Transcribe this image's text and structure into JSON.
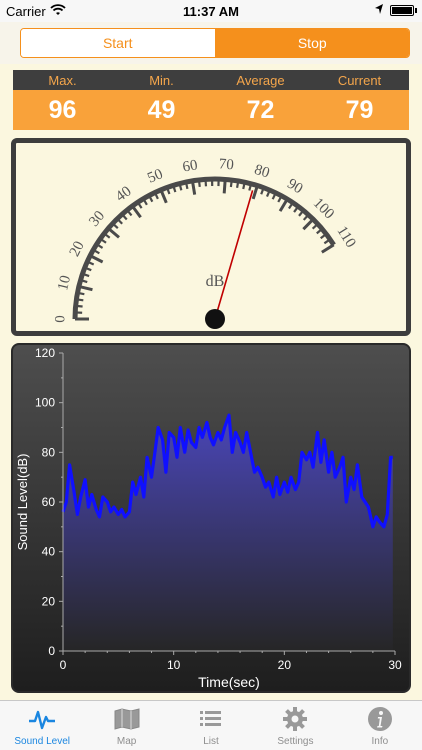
{
  "status_bar": {
    "carrier": "Carrier",
    "time": "11:37 AM"
  },
  "segment": {
    "start_label": "Start",
    "stop_label": "Stop",
    "selected": "Stop"
  },
  "stats": {
    "headers": [
      "Max.",
      "Min.",
      "Average",
      "Current"
    ],
    "values": [
      "96",
      "49",
      "72",
      "79"
    ]
  },
  "gauge": {
    "unit_label": "dB",
    "scale_labels": [
      "0",
      "10",
      "20",
      "30",
      "40",
      "50",
      "60",
      "70",
      "80",
      "90",
      "100",
      "110"
    ],
    "needle_value": 79
  },
  "colors": {
    "accent": "#f5901c",
    "stats_header_bg": "#3e3e3e",
    "stats_value_bg": "#f9a23a",
    "line": "#1010ff",
    "tab_active": "#1a86e0"
  },
  "chart_data": {
    "type": "area",
    "xlabel": "Time(sec)",
    "ylabel": "Sound Level(dB)",
    "xlim": [
      0,
      30
    ],
    "ylim": [
      0,
      120
    ],
    "xticks": [
      "0",
      "10",
      "20",
      "30"
    ],
    "yticks": [
      "0",
      "20",
      "40",
      "60",
      "80",
      "100",
      "120"
    ],
    "x": [
      0,
      0.3,
      0.6,
      1.0,
      1.3,
      1.6,
      2.0,
      2.3,
      2.6,
      3.0,
      3.3,
      3.6,
      4.0,
      4.3,
      4.6,
      5.0,
      5.3,
      5.6,
      6.0,
      6.3,
      6.6,
      7.0,
      7.3,
      7.6,
      8.0,
      8.3,
      8.6,
      9.0,
      9.3,
      9.6,
      10.0,
      10.3,
      10.6,
      11.0,
      11.3,
      11.6,
      12.0,
      12.3,
      12.6,
      13.0,
      13.3,
      13.6,
      14.0,
      14.3,
      14.6,
      15.0,
      15.3,
      15.6,
      16.0,
      16.3,
      16.6,
      17.0,
      17.3,
      17.6,
      18.0,
      18.3,
      18.6,
      19.0,
      19.3,
      19.6,
      20.0,
      20.3,
      20.6,
      21.0,
      21.3,
      21.6,
      22.0,
      22.3,
      22.6,
      23.0,
      23.3,
      23.6,
      24.0,
      24.3,
      24.6,
      25.0,
      25.3,
      25.6,
      26.0,
      26.3,
      26.6,
      27.0,
      27.3,
      27.6,
      28.0,
      28.3,
      28.6,
      29.0,
      29.3,
      29.6,
      29.8
    ],
    "y": [
      56,
      60,
      75,
      64,
      55,
      62,
      69,
      58,
      63,
      57,
      54,
      62,
      60,
      56,
      58,
      55,
      57,
      54,
      56,
      68,
      63,
      70,
      62,
      78,
      70,
      80,
      90,
      85,
      72,
      88,
      86,
      78,
      90,
      80,
      89,
      84,
      82,
      90,
      86,
      92,
      86,
      83,
      88,
      85,
      90,
      95,
      80,
      88,
      84,
      80,
      88,
      79,
      72,
      74,
      70,
      66,
      68,
      62,
      70,
      63,
      68,
      64,
      70,
      65,
      68,
      80,
      77,
      80,
      74,
      88,
      76,
      85,
      72,
      80,
      70,
      74,
      78,
      60,
      70,
      65,
      75,
      62,
      60,
      58,
      50,
      54,
      52,
      50,
      55,
      78,
      78
    ],
    "series": [
      {
        "values_in": "y"
      }
    ]
  },
  "tabs": [
    {
      "label": "Sound Level",
      "icon": "waveform-icon",
      "active": true
    },
    {
      "label": "Map",
      "icon": "map-icon",
      "active": false
    },
    {
      "label": "List",
      "icon": "list-icon",
      "active": false
    },
    {
      "label": "Settings",
      "icon": "gear-icon",
      "active": false
    },
    {
      "label": "Info",
      "icon": "info-icon",
      "active": false
    }
  ]
}
